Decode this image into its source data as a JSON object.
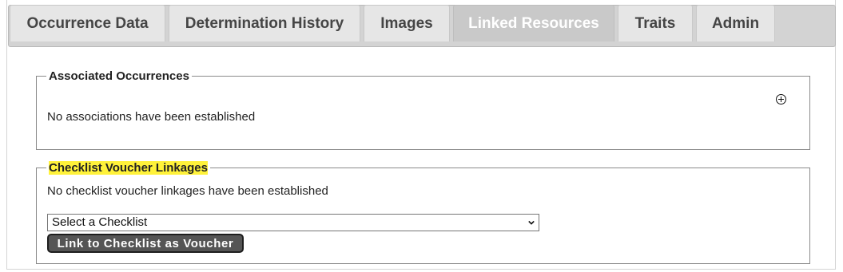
{
  "tabs": [
    {
      "label": "Occurrence Data"
    },
    {
      "label": "Determination History"
    },
    {
      "label": "Images"
    },
    {
      "label": "Linked Resources"
    },
    {
      "label": "Traits"
    },
    {
      "label": "Admin"
    }
  ],
  "active_tab": "Linked Resources",
  "associated": {
    "legend": "Associated Occurrences",
    "message": "No associations have been established",
    "add_icon": "add-circle-icon"
  },
  "checklist": {
    "legend": "Checklist Voucher Linkages",
    "message": "No checklist voucher linkages have been established",
    "select_value": "Select a Checklist",
    "button_label": "Link to Checklist as Voucher",
    "highlight_color": "#fff23a"
  }
}
